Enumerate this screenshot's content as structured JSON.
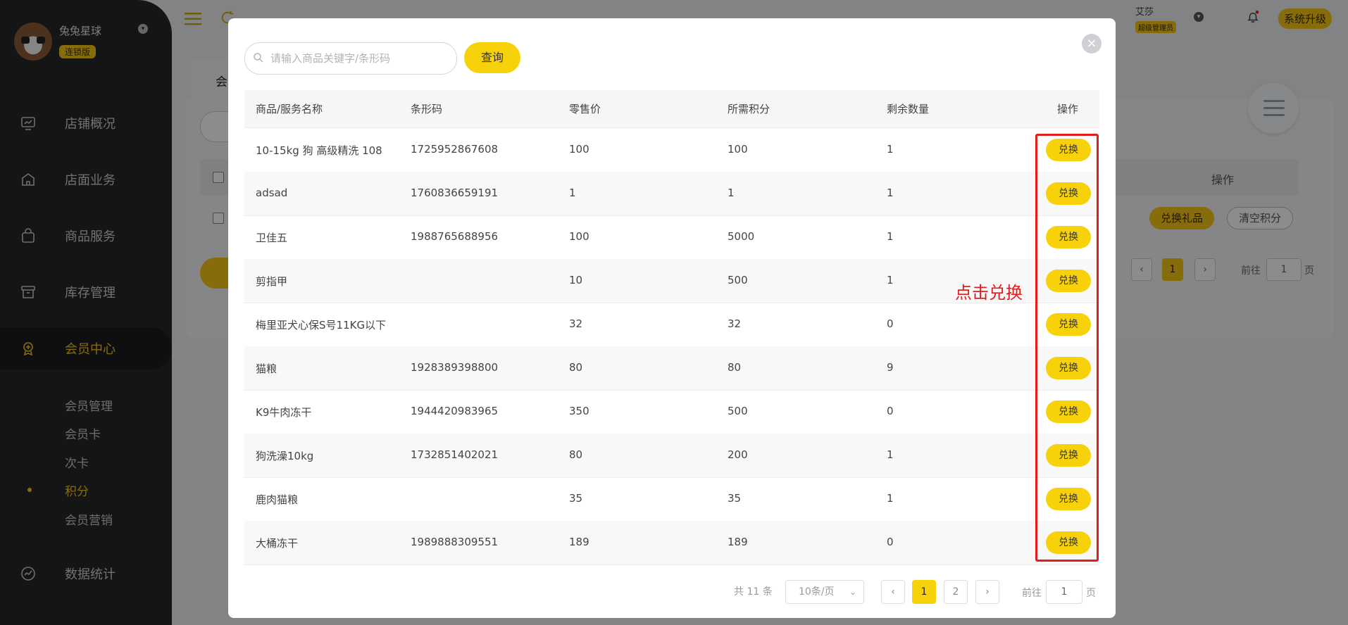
{
  "sidebar": {
    "user_name": "兔兔星球",
    "user_badge": "连锁版",
    "nav": [
      {
        "label": "店铺概况",
        "icon": "dashboard-icon"
      },
      {
        "label": "店面业务",
        "icon": "store-icon"
      },
      {
        "label": "商品服务",
        "icon": "bag-icon"
      },
      {
        "label": "库存管理",
        "icon": "box-icon"
      },
      {
        "label": "会员中心",
        "icon": "member-icon"
      },
      {
        "label": "数据统计",
        "icon": "chart-icon"
      }
    ],
    "sub_items": [
      "会员管理",
      "会员卡",
      "次卡",
      "积分",
      "会员营销"
    ],
    "active_nav": "会员中心",
    "active_sub": "积分"
  },
  "header": {
    "user": "艾莎",
    "role": "超级管理员",
    "upgrade": "系统升级"
  },
  "background_page": {
    "tab_char": "会",
    "op_header": "操作",
    "redeem_gift": "兑换礼品",
    "clear_points": "清空积分",
    "page": "1",
    "goto": "前往",
    "goto_value": "1",
    "page_unit": "页"
  },
  "modal": {
    "search_placeholder": "请输入商品关键字/条形码",
    "query_label": "查询",
    "columns": [
      "商品/服务名称",
      "条形码",
      "零售价",
      "所需积分",
      "剩余数量",
      "操作"
    ],
    "rows": [
      {
        "name": "10-15kg 狗 高级精洗 108",
        "barcode": "1725952867608",
        "price": "100",
        "points": "100",
        "remaining": "1"
      },
      {
        "name": "adsad",
        "barcode": "1760836659191",
        "price": "1",
        "points": "1",
        "remaining": "1"
      },
      {
        "name": "卫佳五",
        "barcode": "1988765688956",
        "price": "100",
        "points": "5000",
        "remaining": "1"
      },
      {
        "name": "剪指甲",
        "barcode": "",
        "price": "10",
        "points": "500",
        "remaining": "1"
      },
      {
        "name": "梅里亚犬心保S号11KG以下",
        "barcode": "",
        "price": "32",
        "points": "32",
        "remaining": "0"
      },
      {
        "name": "猫粮",
        "barcode": "1928389398800",
        "price": "80",
        "points": "80",
        "remaining": "9"
      },
      {
        "name": "K9牛肉冻干",
        "barcode": "1944420983965",
        "price": "350",
        "points": "500",
        "remaining": "0"
      },
      {
        "name": "狗洗澡10kg",
        "barcode": "1732851402021",
        "price": "80",
        "points": "200",
        "remaining": "1"
      },
      {
        "name": "鹿肉猫粮",
        "barcode": "",
        "price": "35",
        "points": "35",
        "remaining": "1"
      },
      {
        "name": "大桶冻干",
        "barcode": "1989888309551",
        "price": "189",
        "points": "189",
        "remaining": "0"
      }
    ],
    "redeem_label": "兑换",
    "annotation": "点击兑换",
    "pagination": {
      "total": "共 11 条",
      "page_size": "10条/页",
      "pages": [
        "1",
        "2"
      ],
      "current": "1",
      "goto_label": "前往",
      "goto_value": "1",
      "page_label": "页"
    }
  },
  "colors": {
    "accent": "#f7d20b",
    "sidebar_bg": "#26272b",
    "annotation": "#e21d1d"
  }
}
